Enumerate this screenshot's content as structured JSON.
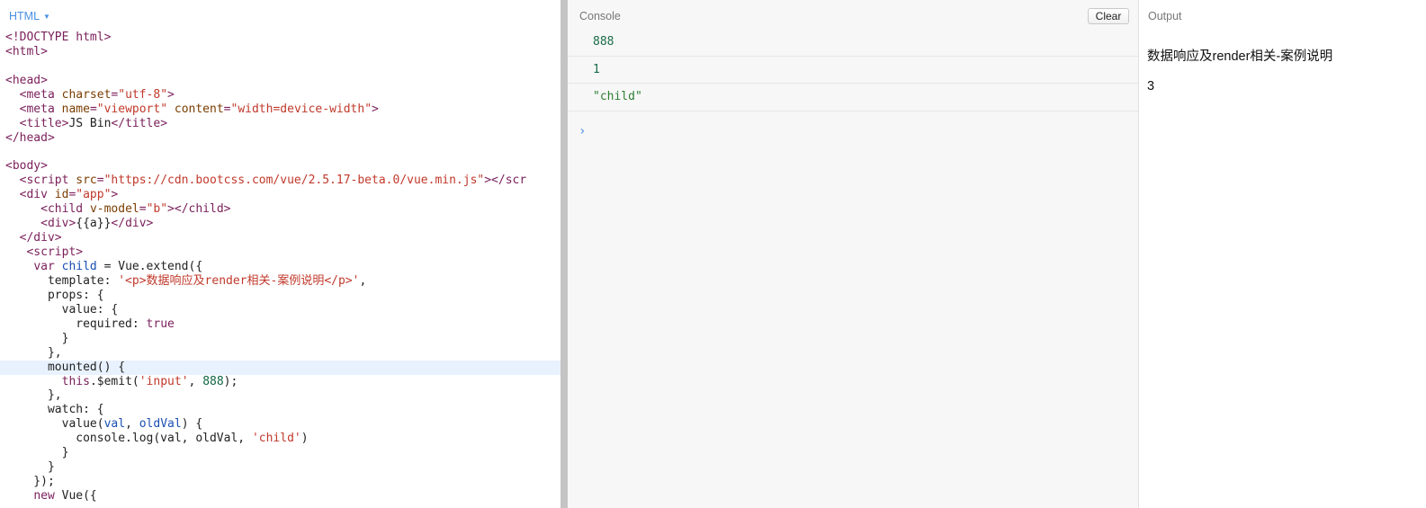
{
  "editor": {
    "language_label": "HTML",
    "lines": [
      [
        {
          "c": "tag",
          "t": "<!DOCTYPE html>"
        }
      ],
      [
        {
          "c": "tag",
          "t": "<html>"
        }
      ],
      [],
      [
        {
          "c": "tag",
          "t": "<head>"
        }
      ],
      [
        {
          "c": "txt",
          "t": "  "
        },
        {
          "c": "tag",
          "t": "<meta "
        },
        {
          "c": "attr",
          "t": "charset"
        },
        {
          "c": "tag",
          "t": "="
        },
        {
          "c": "str",
          "t": "\"utf-8\""
        },
        {
          "c": "tag",
          "t": ">"
        }
      ],
      [
        {
          "c": "txt",
          "t": "  "
        },
        {
          "c": "tag",
          "t": "<meta "
        },
        {
          "c": "attr",
          "t": "name"
        },
        {
          "c": "tag",
          "t": "="
        },
        {
          "c": "str",
          "t": "\"viewport\""
        },
        {
          "c": "tag",
          "t": " "
        },
        {
          "c": "attr",
          "t": "content"
        },
        {
          "c": "tag",
          "t": "="
        },
        {
          "c": "str",
          "t": "\"width=device-width\""
        },
        {
          "c": "tag",
          "t": ">"
        }
      ],
      [
        {
          "c": "txt",
          "t": "  "
        },
        {
          "c": "tag",
          "t": "<title>"
        },
        {
          "c": "txt",
          "t": "JS Bin"
        },
        {
          "c": "tag",
          "t": "</title>"
        }
      ],
      [
        {
          "c": "tag",
          "t": "</head>"
        }
      ],
      [],
      [
        {
          "c": "tag",
          "t": "<body>"
        }
      ],
      [
        {
          "c": "txt",
          "t": "  "
        },
        {
          "c": "tag",
          "t": "<script "
        },
        {
          "c": "attr",
          "t": "src"
        },
        {
          "c": "tag",
          "t": "="
        },
        {
          "c": "str",
          "t": "\"https://cdn.bootcss.com/vue/2.5.17-beta.0/vue.min.js\""
        },
        {
          "c": "tag",
          "t": "></scr"
        }
      ],
      [
        {
          "c": "txt",
          "t": "  "
        },
        {
          "c": "tag",
          "t": "<div "
        },
        {
          "c": "attr",
          "t": "id"
        },
        {
          "c": "tag",
          "t": "="
        },
        {
          "c": "str",
          "t": "\"app\""
        },
        {
          "c": "tag",
          "t": ">"
        }
      ],
      [
        {
          "c": "txt",
          "t": "     "
        },
        {
          "c": "tag",
          "t": "<child "
        },
        {
          "c": "attr",
          "t": "v-model"
        },
        {
          "c": "tag",
          "t": "="
        },
        {
          "c": "str",
          "t": "\"b\""
        },
        {
          "c": "tag",
          "t": "></child>"
        }
      ],
      [
        {
          "c": "txt",
          "t": "     "
        },
        {
          "c": "tag",
          "t": "<div>"
        },
        {
          "c": "txt",
          "t": "{{a}}"
        },
        {
          "c": "tag",
          "t": "</div>"
        }
      ],
      [
        {
          "c": "txt",
          "t": "  "
        },
        {
          "c": "tag",
          "t": "</div>"
        }
      ],
      [
        {
          "c": "txt",
          "t": "   "
        },
        {
          "c": "tag",
          "t": "<script>"
        }
      ],
      [
        {
          "c": "txt",
          "t": "    "
        },
        {
          "c": "kw",
          "t": "var "
        },
        {
          "c": "var",
          "t": "child"
        },
        {
          "c": "txt",
          "t": " = Vue.extend({"
        }
      ],
      [
        {
          "c": "txt",
          "t": "      template: "
        },
        {
          "c": "str",
          "t": "'<p>数据响应及render相关-案例说明</p>'"
        },
        {
          "c": "txt",
          "t": ","
        }
      ],
      [
        {
          "c": "txt",
          "t": "      props: {"
        }
      ],
      [
        {
          "c": "txt",
          "t": "        value: {"
        }
      ],
      [
        {
          "c": "txt",
          "t": "          required: "
        },
        {
          "c": "kw",
          "t": "true"
        }
      ],
      [
        {
          "c": "txt",
          "t": "        }"
        }
      ],
      [
        {
          "c": "txt",
          "t": "      },"
        }
      ],
      [
        {
          "c": "txt",
          "t": "      mounted() {"
        }
      ],
      [
        {
          "c": "txt",
          "t": "        "
        },
        {
          "c": "kw",
          "t": "this"
        },
        {
          "c": "txt",
          "t": ".$emit("
        },
        {
          "c": "str",
          "t": "'input'"
        },
        {
          "c": "txt",
          "t": ", "
        },
        {
          "c": "num",
          "t": "888"
        },
        {
          "c": "txt",
          "t": ");"
        }
      ],
      [
        {
          "c": "txt",
          "t": "      },"
        }
      ],
      [
        {
          "c": "txt",
          "t": "      watch: {"
        }
      ],
      [
        {
          "c": "txt",
          "t": "        value("
        },
        {
          "c": "var",
          "t": "val"
        },
        {
          "c": "txt",
          "t": ", "
        },
        {
          "c": "var",
          "t": "oldVal"
        },
        {
          "c": "txt",
          "t": ") {"
        }
      ],
      [
        {
          "c": "txt",
          "t": "          console.log(val, oldVal, "
        },
        {
          "c": "str",
          "t": "'child'"
        },
        {
          "c": "txt",
          "t": ")"
        }
      ],
      [
        {
          "c": "txt",
          "t": "        }"
        }
      ],
      [
        {
          "c": "txt",
          "t": "      }"
        }
      ],
      [
        {
          "c": "txt",
          "t": "    });"
        }
      ],
      [
        {
          "c": "txt",
          "t": "    "
        },
        {
          "c": "kw",
          "t": "new"
        },
        {
          "c": "txt",
          "t": " Vue({"
        }
      ]
    ],
    "highlighted_line": 23
  },
  "console": {
    "title": "Console",
    "clear_label": "Clear",
    "entries": [
      {
        "type": "num",
        "text": "888"
      },
      {
        "type": "num",
        "text": "1"
      },
      {
        "type": "str",
        "text": "\"child\""
      }
    ],
    "prompt_icon": "chevron-right-icon",
    "prompt_glyph": "›"
  },
  "output": {
    "title": "Output",
    "paragraph": "数据响应及render相关-案例说明",
    "value": "3"
  },
  "colors": {
    "accent": "#4a90e2",
    "string_green": "#2e7d32",
    "number_green": "#1b6b4a"
  }
}
